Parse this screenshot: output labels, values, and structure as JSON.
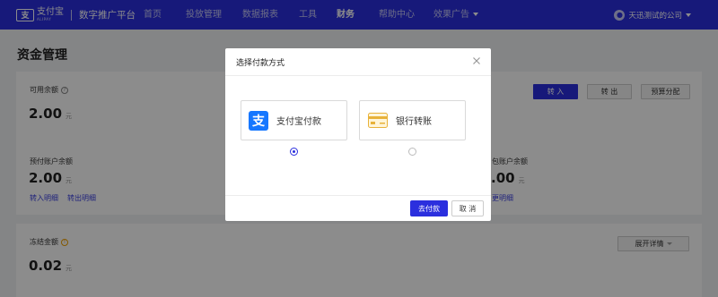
{
  "topbar": {
    "logo_text": "支付宝",
    "logo_sub": "ALIPAY",
    "platform_name": "数字推广平台",
    "nav": [
      {
        "label": "首页"
      },
      {
        "label": "投放管理"
      },
      {
        "label": "数据报表"
      },
      {
        "label": "工具"
      },
      {
        "label": "财务"
      },
      {
        "label": "帮助中心"
      },
      {
        "label": "效果广告"
      }
    ],
    "account_name": "天迅测试的公司"
  },
  "page": {
    "title": "资金管理",
    "available": {
      "label": "可用余额",
      "amount": "2.00",
      "unit": "元",
      "buttons": [
        "转 入",
        "转 出",
        "预算分配"
      ]
    },
    "prepaid": {
      "label": "预付账户余额",
      "amount": "2.00",
      "unit": "元",
      "links": [
        "转入明细",
        "转出明细"
      ]
    },
    "redpacket": {
      "label": "包账户余额",
      "amount": ".00",
      "unit": "元",
      "link": "更明细"
    },
    "frozen": {
      "label": "冻结金额",
      "amount": "0.02",
      "unit": "元",
      "expand_button": "展开详情"
    }
  },
  "modal": {
    "title": "选择付款方式",
    "options": [
      {
        "label": "支付宝付款",
        "icon": "alipay-icon",
        "selected": true
      },
      {
        "label": "银行转账",
        "icon": "bank-card-icon",
        "selected": false
      }
    ],
    "primary_button": "去付款",
    "cancel_button": "取 消"
  },
  "colors": {
    "brand": "#2b2fde",
    "alipay": "#1677ff",
    "card_gold": "#e8b23a"
  }
}
